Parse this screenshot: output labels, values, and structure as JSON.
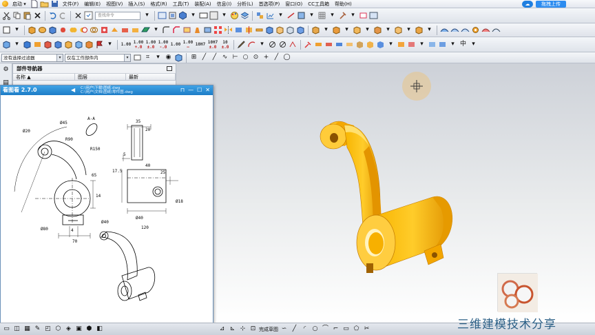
{
  "menu": {
    "start_label": "启动 ▾",
    "items": [
      "文件(F)",
      "编辑(E)",
      "视图(V)",
      "插入(S)",
      "格式(R)",
      "工具(T)",
      "装配(A)",
      "信息(I)",
      "分析(L)",
      "首选项(P)",
      "窗口(O)",
      "CC工具箱",
      "帮助(H)"
    ],
    "upload_label": "拖拽上传"
  },
  "toolbar1": {
    "command_search_placeholder": "查找命令"
  },
  "toolbar3": {
    "tolerance_labels": [
      "1.00",
      "1.00",
      "1.00",
      "1.00",
      "1.00",
      "1.00",
      "10H7",
      "10H7",
      "10"
    ]
  },
  "selection_bar": {
    "filter_value": "没有选择过滤器",
    "scope_value": "仅在工作部件内"
  },
  "navigator": {
    "title": "部件导航器",
    "columns": [
      "名称",
      "图层",
      "最新"
    ]
  },
  "viewer": {
    "title": "看图看 2.7.0",
    "file_line1": "C:\\用户\\下载\\图纸.dwg",
    "file_line2": "C:\\用户\\文档\\图纸\\零件图.dwg"
  },
  "drawing": {
    "dims": [
      "Ø45",
      "Ø20",
      "R90",
      "A-A",
      "R150",
      "65",
      "Ø80",
      "Ø40",
      "4",
      "70",
      "35",
      "20",
      "40",
      "17.5",
      "5",
      "Ø18",
      "Ø40",
      "120",
      "25",
      "14"
    ]
  },
  "bottom": {
    "status": "完成草图"
  },
  "watermark": "三维建模技术分享",
  "colors": {
    "part_orange": "#f2a400",
    "title_blue": "#1d7dc7",
    "watermark": "#2b5f86"
  }
}
